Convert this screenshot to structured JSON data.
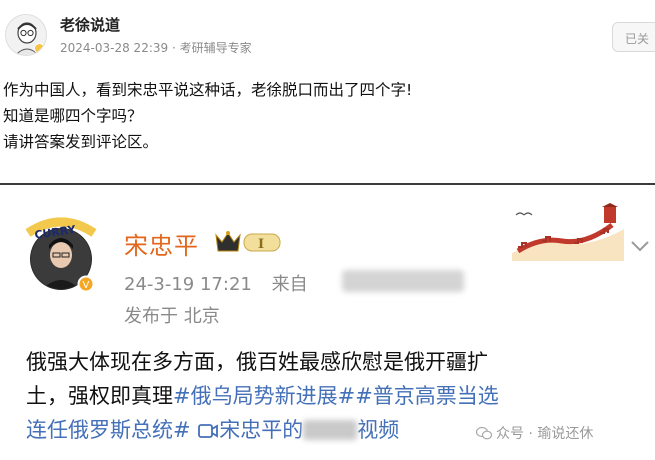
{
  "post": {
    "author": "老徐说道",
    "timestamp": "2024-03-28 22:39",
    "role_tag": "考研辅导专家",
    "follow_label": "已关",
    "lines": [
      "作为中国人，看到宋忠平说这种话，老徐脱口而出了四个字!",
      "知道是哪四个字吗？",
      "请讲答案发到评论区。"
    ]
  },
  "embed": {
    "avatar_text": "CURRY",
    "author": "宋忠平",
    "level": "I",
    "time": "24-3-19 17:21",
    "source_prefix": "来自",
    "location": "发布于 北京",
    "body_line1": "俄强大体现在多方面，俄百姓最感欣慰是俄开疆扩",
    "body_line2_plain": "土，强权即真理",
    "body_line2_tag": "#俄乌局势新进展##普京高票当选",
    "body_line3_tag": "连任俄罗斯总统#",
    "body_line3_video_prefix": "宋忠平的",
    "body_line3_video_suffix": "视频"
  },
  "watermark": {
    "text": "众号 · 瑜说还休"
  },
  "icons": [
    "user-avatar-icon",
    "vip-badge-icon",
    "crown-level-icon",
    "great-wall-decoration-icon",
    "chevron-down-icon",
    "video-camera-icon",
    "wechat-watermark-icon"
  ],
  "colors": {
    "author_orange": "#e2661b",
    "hashtag_blue": "#4470b8",
    "meta_gray": "#8a8a8a"
  }
}
